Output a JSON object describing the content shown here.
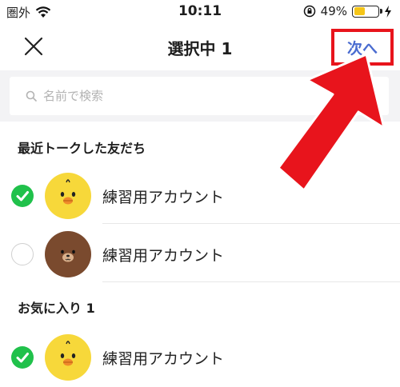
{
  "status_bar": {
    "carrier": "圏外",
    "time": "10:11",
    "battery_percent": "49%",
    "battery_level": 0.49
  },
  "header": {
    "close_icon": "close-icon",
    "title": "選択中 1",
    "next_label": "次へ"
  },
  "search": {
    "placeholder": "名前で検索"
  },
  "sections": {
    "recent_title": "最近トークした友だち",
    "favorites_title": "お気に入り 1"
  },
  "rows": [
    {
      "name": "練習用アカウント",
      "checked": true,
      "avatar": "sally-chick-avatar"
    },
    {
      "name": "練習用アカウント",
      "checked": false,
      "avatar": "brown-bear-avatar"
    },
    {
      "name": "練習用アカウント",
      "checked": true,
      "avatar": "sally-chick-avatar"
    }
  ],
  "colors": {
    "accent_blue": "#4a6cd0",
    "check_green": "#20c14b",
    "highlight_red": "#e8141c"
  }
}
